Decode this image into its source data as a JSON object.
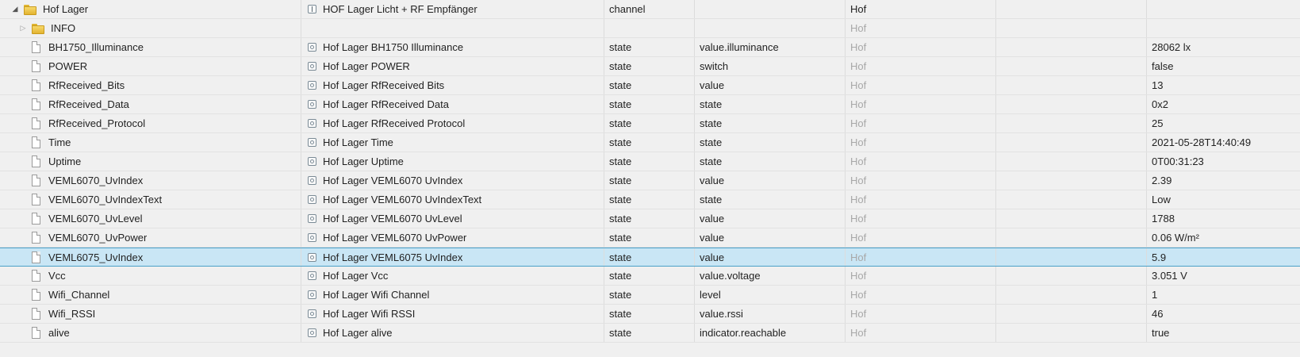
{
  "rows": [
    {
      "id": "Hof Lager",
      "name": "HOF Lager Licht + RF Empfänger",
      "type": "channel",
      "role": "",
      "room": "Hof",
      "func": "",
      "value": ""
    },
    {
      "id": "INFO",
      "name": "",
      "type": "",
      "role": "",
      "room": "Hof",
      "func": "",
      "value": ""
    },
    {
      "id": "BH1750_Illuminance",
      "name": "Hof Lager BH1750 Illuminance",
      "type": "state",
      "role": "value.illuminance",
      "room": "Hof",
      "func": "",
      "value": "28062 lx"
    },
    {
      "id": "POWER",
      "name": "Hof Lager POWER",
      "type": "state",
      "role": "switch",
      "room": "Hof",
      "func": "",
      "value": "false"
    },
    {
      "id": "RfReceived_Bits",
      "name": "Hof Lager RfReceived Bits",
      "type": "state",
      "role": "value",
      "room": "Hof",
      "func": "",
      "value": "13"
    },
    {
      "id": "RfReceived_Data",
      "name": "Hof Lager RfReceived Data",
      "type": "state",
      "role": "state",
      "room": "Hof",
      "func": "",
      "value": "0x2"
    },
    {
      "id": "RfReceived_Protocol",
      "name": "Hof Lager RfReceived Protocol",
      "type": "state",
      "role": "state",
      "room": "Hof",
      "func": "",
      "value": "25"
    },
    {
      "id": "Time",
      "name": "Hof Lager Time",
      "type": "state",
      "role": "state",
      "room": "Hof",
      "func": "",
      "value": "2021-05-28T14:40:49"
    },
    {
      "id": "Uptime",
      "name": "Hof Lager Uptime",
      "type": "state",
      "role": "state",
      "room": "Hof",
      "func": "",
      "value": "0T00:31:23"
    },
    {
      "id": "VEML6070_UvIndex",
      "name": "Hof Lager VEML6070 UvIndex",
      "type": "state",
      "role": "value",
      "room": "Hof",
      "func": "",
      "value": "2.39"
    },
    {
      "id": "VEML6070_UvIndexText",
      "name": "Hof Lager VEML6070 UvIndexText",
      "type": "state",
      "role": "state",
      "room": "Hof",
      "func": "",
      "value": "Low"
    },
    {
      "id": "VEML6070_UvLevel",
      "name": "Hof Lager VEML6070 UvLevel",
      "type": "state",
      "role": "value",
      "room": "Hof",
      "func": "",
      "value": "1788"
    },
    {
      "id": "VEML6070_UvPower",
      "name": "Hof Lager VEML6070 UvPower",
      "type": "state",
      "role": "value",
      "room": "Hof",
      "func": "",
      "value": "0.06 W/m²"
    },
    {
      "id": "VEML6075_UvIndex",
      "name": "Hof Lager VEML6075 UvIndex",
      "type": "state",
      "role": "value",
      "room": "Hof",
      "func": "",
      "value": "5.9"
    },
    {
      "id": "Vcc",
      "name": "Hof Lager Vcc",
      "type": "state",
      "role": "value.voltage",
      "room": "Hof",
      "func": "",
      "value": "3.051 V"
    },
    {
      "id": "Wifi_Channel",
      "name": "Hof Lager Wifi Channel",
      "type": "state",
      "role": "level",
      "room": "Hof",
      "func": "",
      "value": "1"
    },
    {
      "id": "Wifi_RSSI",
      "name": "Hof Lager Wifi RSSI",
      "type": "state",
      "role": "value.rssi",
      "room": "Hof",
      "func": "",
      "value": "46"
    },
    {
      "id": "alive",
      "name": "Hof Lager alive",
      "type": "state",
      "role": "indicator.reachable",
      "room": "Hof",
      "func": "",
      "value": "true"
    }
  ],
  "icons": {
    "expanded": "triangle-down-icon",
    "collapsed": "triangle-right-icon",
    "folder": "folder-icon",
    "file": "file-icon",
    "state": "state-icon",
    "channel": "channel-icon"
  }
}
